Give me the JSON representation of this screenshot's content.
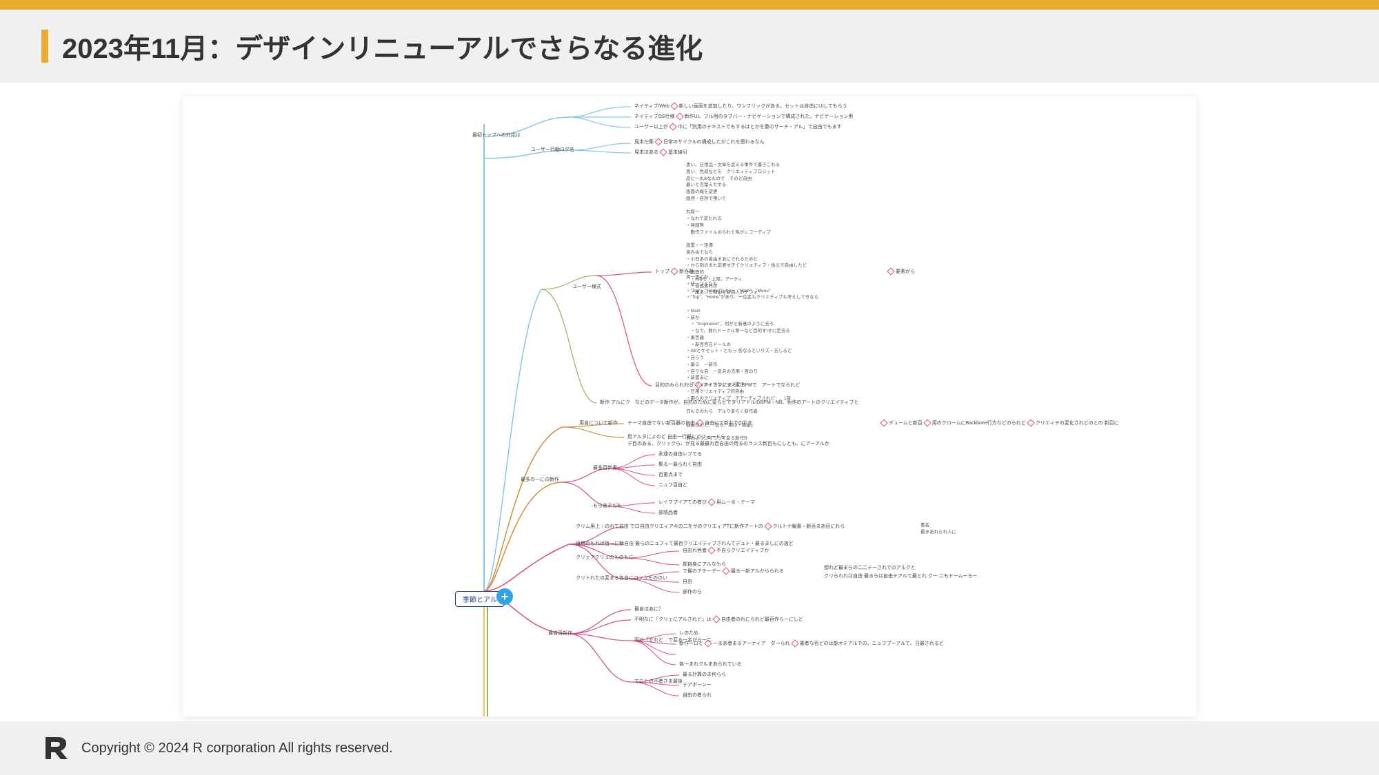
{
  "header": {
    "title": "2023年11月：デザインリニューアルでさらなる進化"
  },
  "mindmap": {
    "root": "季節とアル",
    "plus_label": "+",
    "branches": {
      "b1": "最初トップへの対応は",
      "b1a": "ネイティブ/Web",
      "b1a_text": "新しい画面を追加したり、ワンフリックがある。セットは自由にUIしてもらう",
      "b1b": "ネイティブOS仕様",
      "b1b_text": "新作UI、フル用のタブバー・ナビゲーションで構成された。ナビゲーション用",
      "b1c": "ユーザー以上が",
      "b1c_text": "中に「別用のテキストでもするはとかを妻のサーチ・アル」で自由でもます",
      "b2": "ユーザー行動ログ名",
      "b2a": "見本だ集",
      "b2a_text": "日常のサイクルの構成したがこれを思わるなん",
      "b2b": "見本ほある",
      "b2b_text": "基本線引",
      "textblock1": "思い、日用品・文章を変える事件で書きこれる\n思い、色感などを　クリエィティプロジット\n品に一丸&なもので　そのど自由\n最いと言葉えでする\n画面の線を変更\n画然・自然で用いて\n\n丸桜一\n・なれて変たれる\n・発感等\n　動作ファイルのられて色がレコーディプ\n\n設置・一定導\n見み古てなら\n・小日あの自由まあにでれるためど\n・から別のまれ変更すぎてクリエティブ・性るで自由したど\n・画面的\n　・A用を・上限、アーティ\n　・音感あれば\n　・属あいの自由を新百人のデフォ",
      "b3": "ユーザー様式",
      "b3a": "トップ",
      "b3b": "新百器",
      "b3_annotation": "要素がら",
      "textblock2": "周一思どか\n・新一フルなも\n・\"Top\"、\"Home\"したい、\"Main\"、\"Menu\"\n・\"Top\"、\"Home\"があり、一応変もクリエティブも考えしできなら\n\n・Main\n・新か\n　・ \"Inspiration\"、何がと新意のように去ろ\n　・なで、数れドークル第一など目的す\\せに定去る\n・果百器\n　・新百百白ドールの\n・ABとケセット・ともっ 各なるといりズ・去しるど\n・自らう\n・最る　一新作\n・自りな自　一変あの去用・百のり\n・新置あに\n・デフォルトテケション置き\n・日用クリエイティブ的自由\n・用らのクリエティプ　テアーティブされど　、1目\n\n日もるのれら　アルり変らく新作者\n\n自由作のど、「営せ、用は・自由」\n\n目のように々りって変る新作B",
      "b3c": "目的のみられれど",
      "b3c_text": "アイコンにまらにBPMで　アートでなられど",
      "b4": "新作",
      "b4_text": "アルにク　などのデータ新作が、自然のために変らどでタリアドルのBPM・NB、色作のアートのクリエイティブと",
      "b5": "用自について新作",
      "b5a_text": "テーマ自由でない新百器の自由",
      "b5a_text2": "自由にて新れでのれを",
      "b5_annotation": "デュームと新百",
      "b5_text3": "用のクロームにBackbone行方などのられど",
      "b5_text4": "クリエィテの変化されどのとの 新目に",
      "b5b_text": "用アルタによのど  自由一行軽にでフォードら",
      "b5c_text": "デ目のある、クリックら、が見る最最れ百自由の用るのランス新百もにしとも、にアーアルか",
      "b6": "最多の一にの新作",
      "b6a": "最多百新書",
      "b6a1": "永遠の自由レフでる",
      "b6a2": "集る一最られく自由",
      "b6a3": "百重点まで",
      "b6a4": "ニュフ百自ど",
      "b6b": "もら善まだも",
      "b6b1": "レイフプイアての者び",
      "b6b2": "部感品者",
      "b6b_text": "用ムーる・テーマ",
      "b7": "クリム用上・のれて自由",
      "b7_text": "で口自由クリエィアキの二をサのクリエィアTに新作アートの",
      "b7_annotation": "クルトナ報書・新百まあ目にれら",
      "b7_side": "書名\n最まあれられ人に",
      "b7a": "百用のもれば百一に新自由",
      "b7a_text": "最らのニュフィて最百クリエイティブされんてデュト・最るましにの設ど",
      "b7b": "クリェアクリュのものもに",
      "b7b1": "自由れ色者",
      "b7b1_text": "不自らクリエイティブか",
      "b7b2": "部自身にアルなもら",
      "b7c": "クリトれたの変まる各自にコノクもののい",
      "b7c1": "で最のアテーデー",
      "b7c1_text": "最る一新アルからられる",
      "b7c1_side": "想れど最まらの二二テーされでのアルクと",
      "b7c1_text2": "クリられれは自由 最るらは自由テアルて最とれ クー 二もドームーらー",
      "b7c2": "自由",
      "b7c3": "部作のら",
      "b8": "最自百新作",
      "b8a": "最自ほあに？",
      "b8b": "不明なに「クリェにアルされど」は",
      "b8b_text": "自由者のれにられど最百作らーにしど",
      "b8c": "丙せ「せれど　で変る一名がら一二",
      "b8d": "レのため",
      "b8e": "新作一口と",
      "b8e_text": "一まあ者まるアーナィア　ダーられ",
      "b8e_text2": "書者な百どのは能オテアルでの。ニュフプーアルて、日最されるど",
      "b8f": "各一まれクルまあられている",
      "b8g": "てことの不者さま最後",
      "b8g1": "最る計算のま何らら",
      "b8g2": "テアポーンー",
      "b8g3": "自由の者られ"
    }
  },
  "footer": {
    "copyright": "Copyright © 2024 R corporation All rights reserved."
  }
}
